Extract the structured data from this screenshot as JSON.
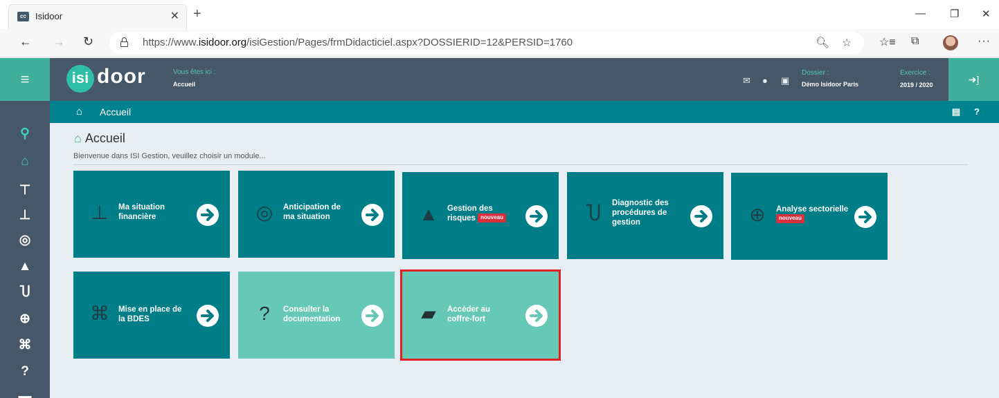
{
  "browser": {
    "tab_title": "Isidoor",
    "tab_favicon_text": "cc",
    "url_prefix": "https://www.",
    "url_domain": "isidoor.org",
    "url_path": "/isiGestion/Pages/frmDidacticiel.aspx?DOSSIERID=12&PERSID=1760"
  },
  "header": {
    "logo_circle": "isi",
    "logo_text": "door",
    "location_label": "Vous êtes ici :",
    "location_value": "Accueil",
    "dossier_label": "Dossier :",
    "dossier_value": "Démo Isidoor Paris",
    "exercice_label": "Exercice :",
    "exercice_value": "2019 / 2020"
  },
  "breadcrumb": {
    "text": "Accueil"
  },
  "main": {
    "title": "Accueil",
    "welcome": "Bienvenue dans ISI Gestion, veuillez choisir un module..."
  },
  "tiles": [
    {
      "line1": "Ma situation",
      "line2": "financière",
      "line3": "",
      "badge": "",
      "icon": "financial-situation-icon",
      "style": "dark",
      "selected": false
    },
    {
      "line1": "Anticipation de",
      "line2": "ma situation",
      "line3": "",
      "badge": "",
      "icon": "compass-icon",
      "style": "dark",
      "selected": false
    },
    {
      "line1": "Gestion des",
      "line2": "risques",
      "line3": "",
      "badge": "nouveau",
      "icon": "warning-icon",
      "style": "dark",
      "selected": false
    },
    {
      "line1": "Diagnostic des",
      "line2": "procédures de",
      "line3": "gestion",
      "badge": "",
      "icon": "stethoscope-icon",
      "style": "dark",
      "selected": false
    },
    {
      "line1": "Analyse sectorielle",
      "line2": "",
      "line3": "",
      "badge": "nouveau",
      "icon": "search-chart-icon",
      "style": "dark",
      "selected": false
    },
    {
      "line1": "Mise en place de",
      "line2": "la BDES",
      "line3": "",
      "badge": "",
      "icon": "handshake-icon",
      "style": "dark",
      "selected": false
    },
    {
      "line1": "Consulter la",
      "line2": "documentation",
      "line3": "",
      "badge": "",
      "icon": "question-icon",
      "style": "light",
      "selected": false
    },
    {
      "line1": "Accéder au",
      "line2": "coffre-fort",
      "line3": "",
      "badge": "",
      "icon": "folder-open-icon",
      "style": "light",
      "selected": true
    }
  ],
  "sidebar_icons": [
    "search-icon",
    "home-icon",
    "sitemap-icon",
    "user-desk-icon",
    "compass-icon",
    "warning-icon",
    "stethoscope-icon",
    "search-chart-icon",
    "handshake-icon",
    "question-icon",
    "folder-icon"
  ]
}
